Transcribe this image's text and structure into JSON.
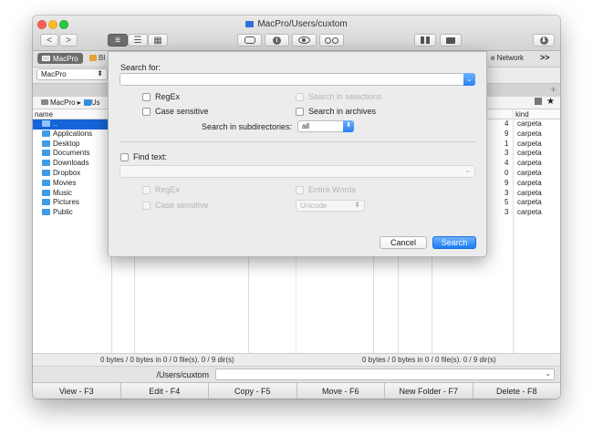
{
  "window": {
    "title": "MacPro/Users/cuxtom"
  },
  "toolbar": {
    "back": "<",
    "forward": ">",
    "info_glyph": "i",
    "download_glyph": "⬇"
  },
  "drives": {
    "active": "MacPro",
    "peek": "Bl",
    "network": "e Network",
    "more": ">>"
  },
  "volume_select": {
    "value": "MacPro"
  },
  "path": {
    "label": "MacPro ▸",
    "peek": "Us"
  },
  "left_panel": {
    "col_name": "name",
    "rows": [
      {
        "name": "..",
        "num": "4",
        "kind": "carpeta",
        "selected": true
      },
      {
        "name": "Applications",
        "num": "9",
        "kind": "carpeta"
      },
      {
        "name": "Desktop",
        "num": "1",
        "kind": "carpeta"
      },
      {
        "name": "Documents",
        "num": "3",
        "kind": "carpeta"
      },
      {
        "name": "Downloads",
        "num": "4",
        "kind": "carpeta"
      },
      {
        "name": "Dropbox",
        "num": "0",
        "kind": "carpeta"
      },
      {
        "name": "Movies",
        "num": "9",
        "kind": "carpeta"
      },
      {
        "name": "Music",
        "num": "3",
        "kind": "carpeta"
      },
      {
        "name": "Pictures",
        "num": "5",
        "kind": "carpeta"
      },
      {
        "name": "Public",
        "num": "3",
        "kind": "carpeta"
      }
    ],
    "col_kind": "kind"
  },
  "status": {
    "left": "0 bytes / 0 bytes in 0 / 0 file(s). 0 / 9 dir(s)",
    "right": "0 bytes / 0 bytes in 0 / 0 file(s). 0 / 9 dir(s)"
  },
  "command": {
    "label": "/Users/cuxtom",
    "value": ""
  },
  "fkeys": [
    "View - F3",
    "Edit - F4",
    "Copy - F5",
    "Move - F6",
    "New Folder - F7",
    "Delete - F8"
  ],
  "dialog": {
    "search_for_label": "Search for:",
    "search_value": "",
    "regex": "RegEx",
    "case_sensitive": "Case sensitive",
    "search_in_selections": "Search in selections",
    "search_in_archives": "Search in archives",
    "subdir_label": "Search in subdirectories:",
    "subdir_value": "all",
    "find_text": "Find text:",
    "find_value": "",
    "regex2": "RegEx",
    "case_sensitive2": "Case sensitive",
    "entire_words": "Entire Words",
    "encoding": "Unicode",
    "cancel": "Cancel",
    "search": "Search"
  }
}
